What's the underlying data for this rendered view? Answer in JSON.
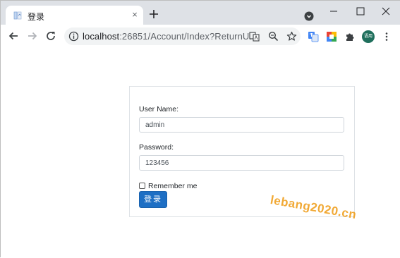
{
  "tab": {
    "title": "登录",
    "close": "×"
  },
  "address_bar": {
    "host": "localhost",
    "rest": ":26851/Account/Index?ReturnU..."
  },
  "profile": {
    "label": "语用"
  },
  "login": {
    "username_label": "User Name:",
    "username_value": "admin",
    "password_label": "Password:",
    "password_value": "123456",
    "remember_label": "Remember me",
    "remember_checked": false,
    "submit_label": "登录"
  },
  "watermark": "lebang2020.cn",
  "colors": {
    "accent": "#1e6fc4",
    "watermark": "#f0a020",
    "tabstrip": "#dee1e6"
  }
}
